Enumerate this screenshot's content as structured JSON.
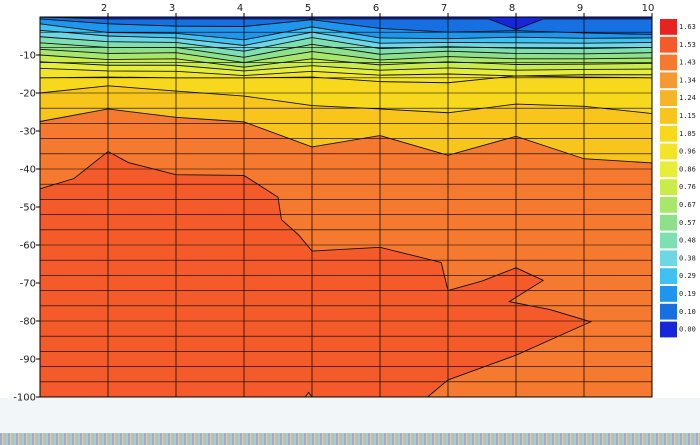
{
  "chart_data": {
    "type": "filled-contour",
    "x": [
      1,
      2,
      3,
      4,
      5,
      6,
      7,
      8,
      9,
      10
    ],
    "x_tick_labels": [
      "2",
      "3",
      "4",
      "5",
      "6",
      "7",
      "8",
      "9",
      "10"
    ],
    "xlim": [
      1,
      10
    ],
    "xaxis_position": "top",
    "ylim": [
      -100,
      0
    ],
    "y_tick_labels": [
      "-10",
      "-20",
      "-30",
      "-40",
      "-50",
      "-60",
      "-70",
      "-80",
      "-90",
      "-100"
    ],
    "y_grid_step": 4,
    "grid": true,
    "colorbar": {
      "position": "right",
      "levels": [
        "1.63",
        "1.53",
        "1.43",
        "1.34",
        "1.24",
        "1.15",
        "1.05",
        "0.96",
        "0.86",
        "0.76",
        "0.67",
        "0.57",
        "0.48",
        "0.38",
        "0.29",
        "0.19",
        "0.10",
        "0.00"
      ],
      "colors": [
        "#e8231f",
        "#f45a2a",
        "#f57a30",
        "#f59a32",
        "#f6b42a",
        "#f7c51c",
        "#f7d81c",
        "#f3e329",
        "#e6ee3a",
        "#c9ec4a",
        "#a9e66c",
        "#8fe08a",
        "#7ee0b0",
        "#6fd6e6",
        "#3fc2f2",
        "#1f96ee",
        "#1670e2",
        "#1626d8"
      ]
    },
    "contour_lines": [
      {
        "level": 0.1,
        "x": [
          1,
          2,
          3,
          4,
          5,
          6,
          7,
          7.6,
          8,
          8.4,
          9,
          10
        ],
        "y": [
          0,
          -0.5,
          -0.5,
          -0.5,
          -0.5,
          -0.5,
          -0.5,
          -0.5,
          -3.3,
          -0.5,
          -0.5,
          -0.5
        ]
      },
      {
        "level": 0.19,
        "x": [
          1,
          2,
          3,
          4,
          5,
          6,
          7,
          8,
          9,
          10
        ],
        "y": [
          -0.5,
          -1.8,
          -2.4,
          -2.5,
          -0.7,
          -3.0,
          -4.0,
          -3.6,
          -4.2,
          -4.6
        ]
      },
      {
        "level": 0.29,
        "x": [
          1,
          2,
          3,
          4,
          5,
          6,
          7,
          8,
          9,
          10
        ],
        "y": [
          -1.8,
          -4.1,
          -4.3,
          -6.0,
          -2.6,
          -5.5,
          -5.7,
          -5.3,
          -5.6,
          -5.5
        ]
      },
      {
        "level": 0.38,
        "x": [
          1,
          2,
          3,
          4,
          5,
          6,
          7,
          8,
          9,
          10
        ],
        "y": [
          -3.5,
          -5.0,
          -5.5,
          -7.5,
          -4.0,
          -6.9,
          -6.7,
          -6.8,
          -6.9,
          -6.7
        ]
      },
      {
        "level": 0.48,
        "x": [
          1,
          2,
          3,
          4,
          5,
          6,
          7,
          8,
          9,
          10
        ],
        "y": [
          -5.2,
          -6.5,
          -6.7,
          -9.0,
          -5.4,
          -8.3,
          -7.8,
          -8.2,
          -8.3,
          -8.0
        ]
      },
      {
        "level": 0.57,
        "x": [
          1,
          2,
          3,
          4,
          5,
          6,
          7,
          8,
          9,
          10
        ],
        "y": [
          -6.8,
          -8.0,
          -8.0,
          -10.6,
          -7.2,
          -9.8,
          -9.0,
          -9.6,
          -9.7,
          -9.4
        ]
      },
      {
        "level": 0.67,
        "x": [
          1,
          2,
          3,
          4,
          5,
          6,
          7,
          8,
          9,
          10
        ],
        "y": [
          -8.5,
          -9.6,
          -9.4,
          -12.0,
          -9.1,
          -11.3,
          -10.4,
          -11.0,
          -11.0,
          -10.8
        ]
      },
      {
        "level": 0.76,
        "x": [
          1,
          2,
          3,
          4,
          5,
          6,
          7,
          8,
          9,
          10
        ],
        "y": [
          -10.0,
          -11.2,
          -11.0,
          -13.2,
          -11.0,
          -12.6,
          -11.8,
          -12.5,
          -12.4,
          -12.2
        ]
      },
      {
        "level": 0.86,
        "x": [
          1,
          2,
          3,
          4,
          5,
          6,
          7,
          8,
          9,
          10
        ],
        "y": [
          -11.8,
          -12.7,
          -12.7,
          -14.2,
          -12.8,
          -14.0,
          -13.4,
          -14.0,
          -13.8,
          -13.7
        ]
      },
      {
        "level": 0.96,
        "x": [
          1,
          2,
          3,
          4,
          5,
          6,
          7,
          8,
          9,
          10
        ],
        "y": [
          -13.5,
          -14.2,
          -14.3,
          -15.4,
          -14.3,
          -15.3,
          -15.0,
          -15.5,
          -15.2,
          -15.2
        ]
      },
      {
        "level": 1.05,
        "x": [
          1,
          2,
          3,
          4,
          5,
          6,
          7,
          8,
          9,
          10
        ],
        "y": [
          -16.0,
          -15.8,
          -16.0,
          -16.0,
          -15.8,
          -17.0,
          -17.3,
          -15.5,
          -15.8,
          -16.0
        ]
      },
      {
        "level": 1.15,
        "x": [
          1,
          2,
          3,
          4,
          5,
          6,
          7,
          8,
          9,
          10
        ],
        "y": [
          -20.0,
          -18.1,
          -19.5,
          -20.8,
          -23.3,
          -24.2,
          -25.2,
          -22.9,
          -23.5,
          -25.4
        ]
      },
      {
        "level": 1.24,
        "x": [
          1,
          2,
          3,
          4,
          5,
          6,
          7,
          8,
          9,
          10
        ],
        "y": [
          -27.5,
          -24.2,
          -26.4,
          -27.6,
          -34.2,
          -31.2,
          -36.4,
          -31.4,
          -37.3,
          -38.4
        ]
      },
      {
        "level": 1.34,
        "x": [
          1,
          1.5,
          2,
          2.3,
          3,
          4,
          4.5,
          4.55,
          4.8,
          5,
          6,
          6.9,
          7,
          7.5,
          8,
          8.4,
          7.9,
          8.5,
          9.1,
          8.5,
          8.0,
          7.0,
          6.7,
          5.0,
          4.95,
          4.9
        ],
        "y": [
          -45.2,
          -42.5,
          -35.4,
          -38.3,
          -41.5,
          -41.7,
          -47.4,
          -53.3,
          -57.3,
          -61.6,
          -60.6,
          -64.6,
          -72.0,
          -69.5,
          -66.0,
          -69.3,
          -74.9,
          -77.0,
          -80.2,
          -85.0,
          -89.0,
          -95.5,
          -100.0,
          -100.0,
          -98.8,
          -100.0
        ]
      }
    ]
  }
}
